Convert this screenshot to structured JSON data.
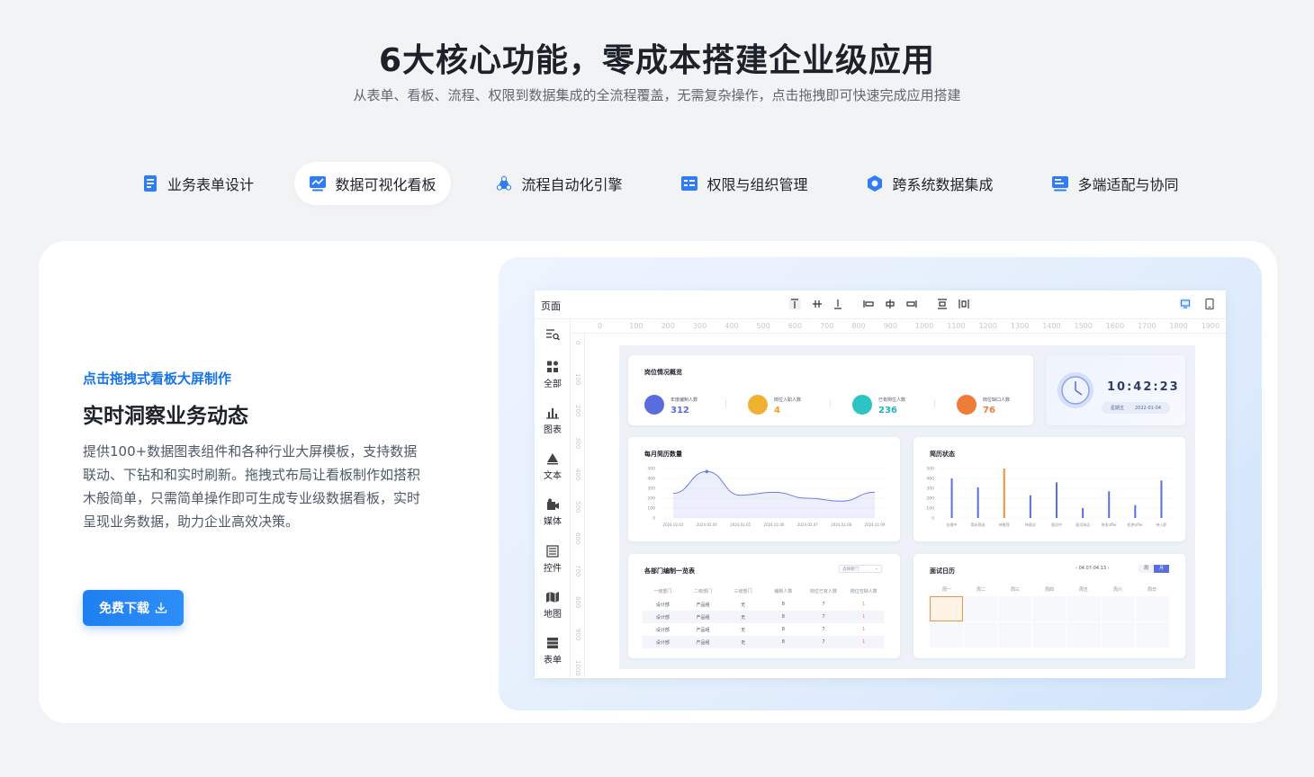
{
  "header": {
    "title": "6大核心功能，零成本搭建企业级应用",
    "subtitle": "从表单、看板、流程、权限到数据集成的全流程覆盖，无需复杂操作，点击拖拽即可快速完成应用搭建"
  },
  "tabs": [
    {
      "label": "业务表单设计",
      "icon": "form-icon",
      "active": false
    },
    {
      "label": "数据可视化看板",
      "icon": "chart-board-icon",
      "active": true
    },
    {
      "label": "流程自动化引擎",
      "icon": "workflow-icon",
      "active": false
    },
    {
      "label": "权限与组织管理",
      "icon": "permission-icon",
      "active": false
    },
    {
      "label": "跨系统数据集成",
      "icon": "integration-icon",
      "active": false
    },
    {
      "label": "多端适配与协同",
      "icon": "multi-device-icon",
      "active": false
    }
  ],
  "feature": {
    "tagline": "点击拖拽式看板大屏制作",
    "heading": "实时洞察业务动态",
    "description": "提供100+数据图表组件和各种行业大屏模板，支持数据联动、下钻和和实时刷新。拖拽式布局让看板制作如搭积木般简单，只需简单操作即可生成专业级数据看板，实时呈现业务数据，助力企业高效决策。",
    "download_label": "免费下载"
  },
  "colors": {
    "accent": "#1774e8",
    "chart_line": "#6b7ce8",
    "bar_highlight": "#f0923a",
    "bar_default": "#5a6fdc"
  },
  "editor": {
    "page_label": "页面",
    "sidebar": [
      {
        "label": "",
        "icon": "search-list-icon"
      },
      {
        "label": "全部",
        "icon": "grid-icon"
      },
      {
        "label": "图表",
        "icon": "bar-chart-icon"
      },
      {
        "label": "文本",
        "icon": "text-icon"
      },
      {
        "label": "媒体",
        "icon": "media-icon"
      },
      {
        "label": "控件",
        "icon": "control-icon"
      },
      {
        "label": "地图",
        "icon": "map-icon"
      },
      {
        "label": "表单",
        "icon": "table-icon"
      }
    ],
    "ruler_h": [
      "0",
      "100",
      "200",
      "300",
      "400",
      "500",
      "600",
      "700",
      "800",
      "900",
      "1000",
      "1100",
      "1200",
      "1300",
      "1400",
      "1500",
      "1600",
      "1700",
      "1800",
      "1900"
    ],
    "ruler_v": [
      "0",
      "100",
      "200",
      "300",
      "400",
      "500",
      "600",
      "700",
      "800",
      "900",
      "1000"
    ]
  },
  "dashboard": {
    "overview": {
      "title": "岗位情况概览",
      "kpis": [
        {
          "label": "年度编制人数",
          "value": "312",
          "color": "#5b6cdc"
        },
        {
          "label": "岗位入职人数",
          "value": "4",
          "color": "#f0b030"
        },
        {
          "label": "已有岗位人数",
          "value": "236",
          "color": "#2ec4c4"
        },
        {
          "label": "岗位缺口人数",
          "value": "76",
          "color": "#f07c3a"
        }
      ]
    },
    "clock": {
      "time": "10:42:23",
      "weekday": "星期五",
      "date": "2022-01-04"
    },
    "monthly": {
      "title": "每月简历数量"
    },
    "status": {
      "title": "简历状态"
    },
    "table": {
      "title": "各部门编制一览表",
      "filter": "选择部门",
      "columns": [
        "一级部门",
        "二级部门",
        "三级部门",
        "编制人数",
        "岗位已有人数",
        "岗位空缺人数"
      ],
      "rows": [
        [
          "设计部",
          "产品组",
          "无",
          "8",
          "7",
          "1"
        ],
        [
          "设计部",
          "产品组",
          "无",
          "8",
          "7",
          "1"
        ],
        [
          "设计部",
          "产品组",
          "无",
          "8",
          "7",
          "1"
        ],
        [
          "设计部",
          "产品组",
          "无",
          "8",
          "7",
          "1"
        ]
      ]
    },
    "calendar": {
      "title": "面试日历",
      "range": "04.07-04.13",
      "view_week": "周",
      "view_month": "月",
      "days": [
        "周一",
        "周二",
        "周三",
        "周四",
        "周五",
        "周六",
        "周日"
      ]
    }
  },
  "chart_data": [
    {
      "type": "line",
      "title": "每月简历数量",
      "x": [
        "2024.02.03",
        "2024.02.04",
        "2024.02.05",
        "2024.02.06",
        "2024.02.07",
        "2024.02.08",
        "2024.02.09"
      ],
      "series": [
        {
          "values": [
            250,
            470,
            230,
            260,
            200,
            170,
            260
          ]
        }
      ],
      "ylim": [
        0,
        500
      ],
      "yticks": [
        "0",
        "100",
        "200",
        "300",
        "400",
        "500"
      ]
    },
    {
      "type": "bar",
      "title": "简历状态",
      "categories": [
        "处理中",
        "简历筛选",
        "待推荐",
        "待面试",
        "面试中",
        "面试淘汰",
        "待发offer",
        "拒绝offer",
        "待入职"
      ],
      "values": [
        400,
        310,
        500,
        230,
        360,
        100,
        270,
        130,
        380
      ],
      "highlight_index": 2,
      "ylim": [
        0,
        500
      ],
      "yticks": [
        "0",
        "100",
        "200",
        "300",
        "400",
        "500"
      ]
    }
  ]
}
